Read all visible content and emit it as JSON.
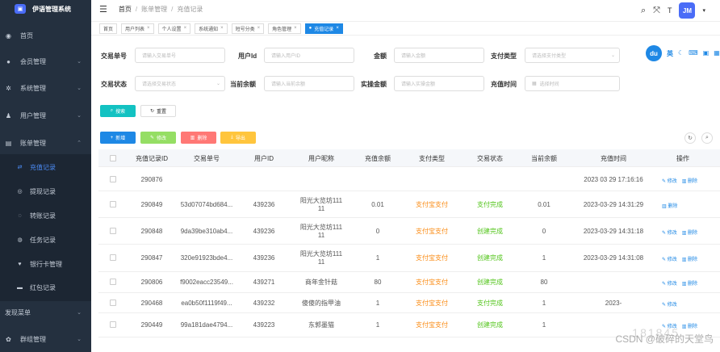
{
  "app": {
    "title": "伊语管理系统",
    "logo": "chat-bubble-icon"
  },
  "sidebar": {
    "items": [
      {
        "label": "首页",
        "icon": "dashboard-icon"
      },
      {
        "label": "会员管理",
        "icon": "member-icon"
      },
      {
        "label": "系统管理",
        "icon": "gear-icon"
      },
      {
        "label": "用户管理",
        "icon": "user-icon"
      },
      {
        "label": "账单管理",
        "icon": "bill-icon"
      }
    ],
    "subitems": [
      {
        "label": "充值记录",
        "active": true
      },
      {
        "label": "提现记录"
      },
      {
        "label": "转账记录"
      },
      {
        "label": "任务记录"
      },
      {
        "label": "银行卡管理"
      },
      {
        "label": "红包记录"
      }
    ],
    "bottom_items": [
      {
        "label": "发现菜单"
      },
      {
        "label": "群组管理"
      }
    ]
  },
  "topbar": {
    "breadcrumb": [
      "首页",
      "账单管理",
      "充值记录"
    ],
    "avatar_text": "JM"
  },
  "tags": [
    {
      "label": "首页"
    },
    {
      "label": "用户列表"
    },
    {
      "label": "个人设置"
    },
    {
      "label": "系统通知"
    },
    {
      "label": "短号分类"
    },
    {
      "label": "角色管理"
    },
    {
      "label": "充值记录",
      "active": true
    }
  ],
  "filters": {
    "trade_no": {
      "label": "交易单号",
      "placeholder": "请输入交易单号"
    },
    "user_id": {
      "label": "用户Id",
      "placeholder": "请输入用户ID"
    },
    "amount": {
      "label": "金额",
      "placeholder": "请输入金额"
    },
    "pay_type": {
      "label": "支付类型",
      "placeholder": "请选择支付类型"
    },
    "trade_status": {
      "label": "交易状态",
      "placeholder": "请选择交易状态"
    },
    "cur_balance": {
      "label": "当前余额",
      "placeholder": "请输入当前余额"
    },
    "real_amount": {
      "label": "实操金额",
      "placeholder": "请输入实操金额"
    },
    "recharge_time": {
      "label": "充值时间",
      "placeholder": "选择时间"
    }
  },
  "actions": {
    "search": "搜索",
    "reset": "重置",
    "add": "新增",
    "edit": "修改",
    "delete": "删除",
    "export": "导出"
  },
  "table": {
    "columns": [
      "充值记录ID",
      "交易单号",
      "用户ID",
      "用户昵称",
      "充值余额",
      "支付类型",
      "交易状态",
      "当前余额",
      "充值时间",
      "操作"
    ],
    "rows": [
      {
        "id": "290876",
        "trade_no": "",
        "uid": "",
        "nick": "",
        "amount": "",
        "pay_type": "",
        "status": "",
        "balance": "",
        "time": "2023 03 29 17:16:16",
        "ops": "修改 删除"
      },
      {
        "id": "290849",
        "trade_no": "53d07074bd684...",
        "uid": "439236",
        "nick": "阳光大览坊111\n11",
        "amount": "0.01",
        "pay_type": "支付宝支付",
        "status": "支付完成",
        "balance": "0.01",
        "time": "2023-03-29 14:31:29",
        "ops": "删除"
      },
      {
        "id": "290848",
        "trade_no": "9da39be310ab4...",
        "uid": "439236",
        "nick": "阳光大览坊111\n11",
        "amount": "0",
        "pay_type": "支付宝支付",
        "status": "创建完成",
        "balance": "0",
        "time": "2023-03-29 14:31:18",
        "ops": "修改 删除"
      },
      {
        "id": "290847",
        "trade_no": "320e91923bde4...",
        "uid": "439236",
        "nick": "阳光大览坊111\n11",
        "amount": "1",
        "pay_type": "支付宝支付",
        "status": "创建完成",
        "balance": "1",
        "time": "2023-03-29 14:31:08",
        "ops": "修改 删除"
      },
      {
        "id": "290806",
        "trade_no": "f9002eacc23549...",
        "uid": "439271",
        "nick": "商年金针菇",
        "amount": "80",
        "pay_type": "支付宝支付",
        "status": "创建完成",
        "balance": "80",
        "time": "",
        "ops": "修改 删除"
      },
      {
        "id": "290468",
        "trade_no": "ea0b50f1119f49...",
        "uid": "439232",
        "nick": "傻傻的指甲油",
        "amount": "1",
        "pay_type": "支付宝支付",
        "status": "支付完成",
        "balance": "1",
        "time": "2023-",
        "ops": "修改"
      },
      {
        "id": "290449",
        "trade_no": "99a181dae4794...",
        "uid": "439223",
        "nick": "东郭墨猫",
        "amount": "1",
        "pay_type": "支付宝支付",
        "status": "创建完成",
        "balance": "1",
        "time": "",
        "ops": "修改 删除"
      }
    ]
  },
  "float_tool": {
    "logo": "du",
    "lang": "英"
  },
  "watermark": "CSDN @破碎的天堂鸟",
  "watermark_num": "181845"
}
